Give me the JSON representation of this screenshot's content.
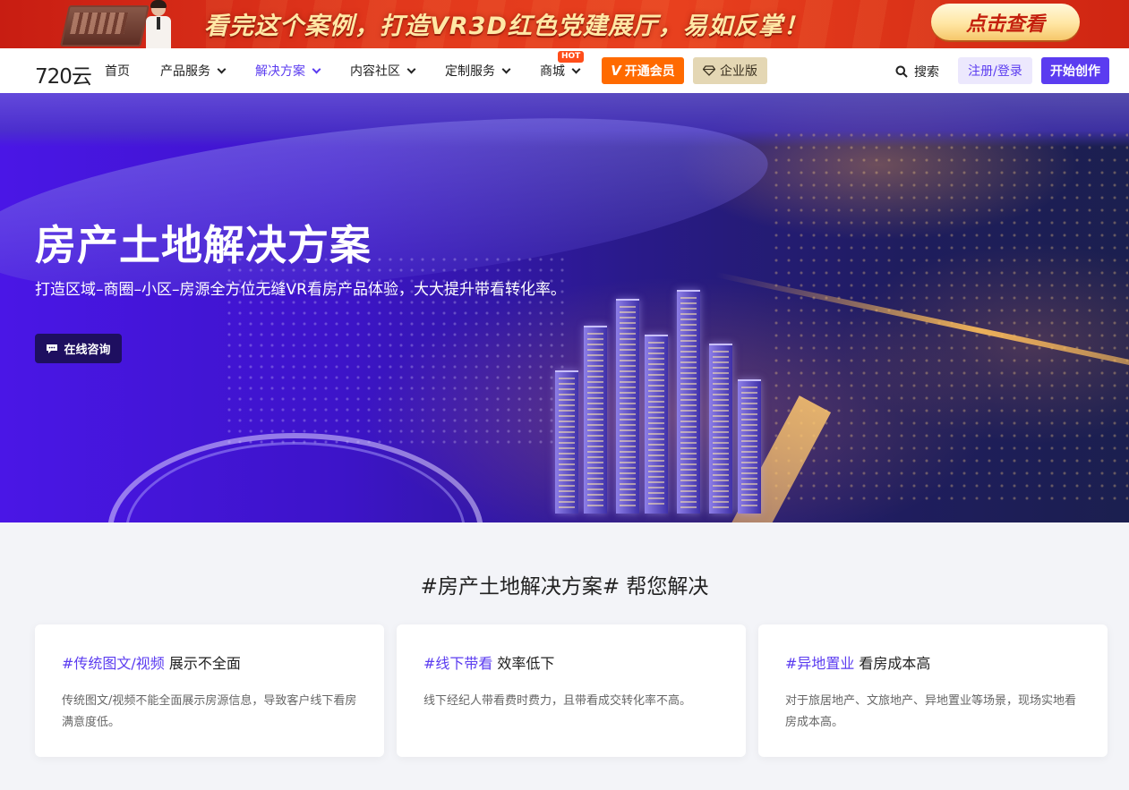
{
  "promo": {
    "headline": "看完这个案例，打造VR3D红色党建展厅，易如反掌！",
    "cta_label": "点击查看"
  },
  "nav": {
    "logo": "720云",
    "menu": [
      {
        "label": "首页"
      },
      {
        "label": "产品服务"
      },
      {
        "label": "解决方案"
      },
      {
        "label": "内容社区"
      },
      {
        "label": "定制服务"
      },
      {
        "label": "商城",
        "badge": "HOT"
      }
    ],
    "vip_label": "开通会员",
    "vip_mark": "V",
    "enterprise_label": "企业版",
    "search_label": "搜索",
    "login_label": "注册/登录",
    "create_label": "开始创作",
    "colors": {
      "accent": "#5b3cf0",
      "vip": "#ff6a00",
      "enterprise": "#e4d7b4"
    }
  },
  "hero": {
    "title": "房产土地解决方案",
    "subtitle": "打造区域–商圈–小区–房源全方位无缝VR看房产品体验，大大提升带看转化率。",
    "consult_label": "在线咨询"
  },
  "section": {
    "title": "#房产土地解决方案# 帮您解决",
    "cards": [
      {
        "tag": "#传统图文/视频",
        "title": "展示不全面",
        "desc": "传统图文/视频不能全面展示房源信息，导致客户线下看房满意度低。"
      },
      {
        "tag": "#线下带看",
        "title": "效率低下",
        "desc": "线下经纪人带看费时费力，且带看成交转化率不高。"
      },
      {
        "tag": "#异地置业",
        "title": "看房成本高",
        "desc": "对于旅居地产、文旅地产、异地置业等场景，现场实地看房成本高。"
      }
    ]
  }
}
